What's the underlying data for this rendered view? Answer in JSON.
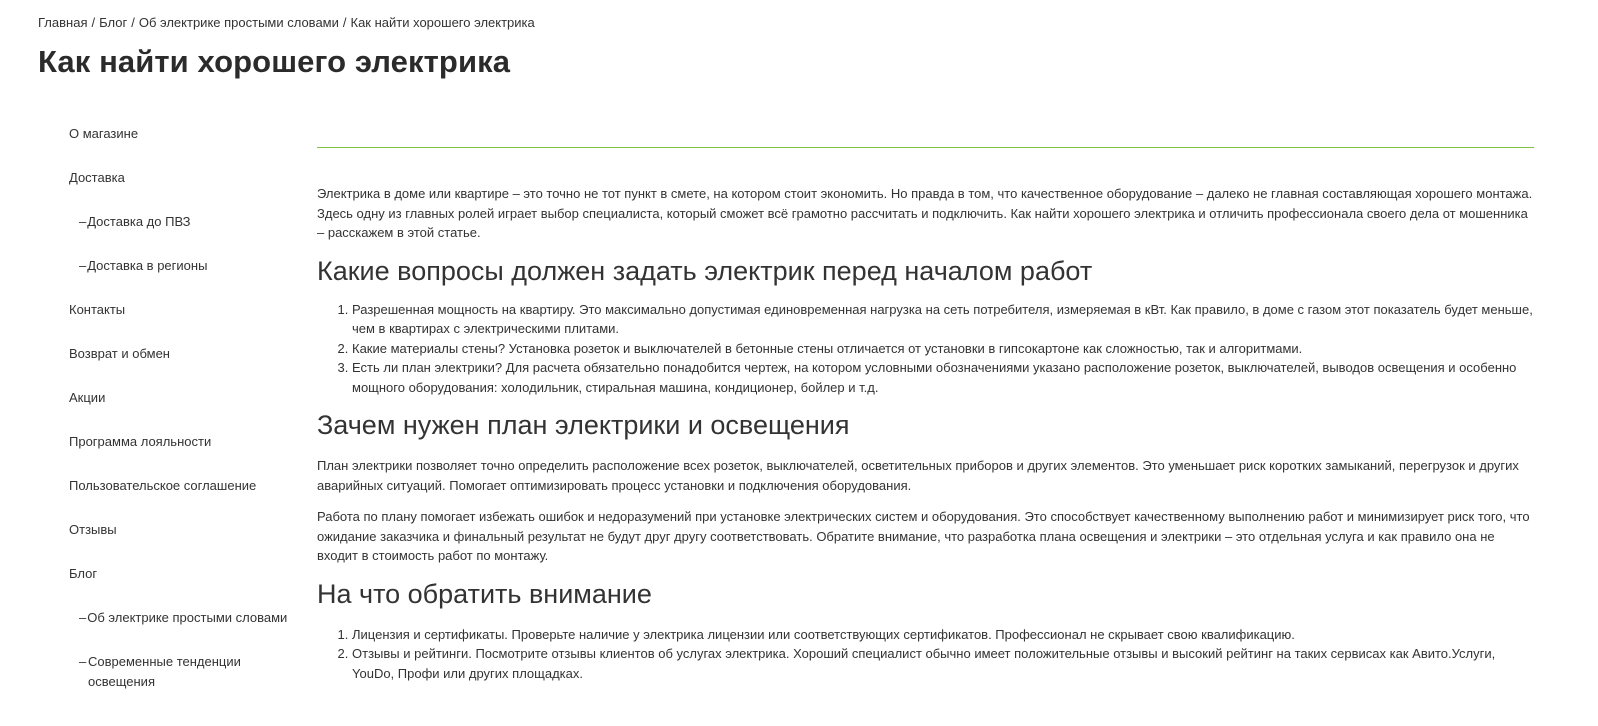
{
  "breadcrumb": [
    {
      "label": "Главная"
    },
    {
      "label": "Блог"
    },
    {
      "label": "Об электрике простыми словами"
    },
    {
      "label": "Как найти хорошего электрика"
    }
  ],
  "breadcrumb_separator": "/",
  "page_title": "Как найти хорошего электрика",
  "sidebar": {
    "items": [
      {
        "label": "О магазине"
      },
      {
        "label": "Доставка"
      },
      {
        "label": "Доставка до ПВЗ"
      },
      {
        "label": "Доставка в регионы"
      },
      {
        "label": "Контакты"
      },
      {
        "label": "Возврат и обмен"
      },
      {
        "label": "Акции"
      },
      {
        "label": "Программа лояльности"
      },
      {
        "label": "Пользовательское соглашение"
      },
      {
        "label": "Отзывы"
      },
      {
        "label": "Блог"
      },
      {
        "label": "Об электрике простыми словами"
      },
      {
        "label": "Современные тенденции освещения"
      }
    ],
    "dash": "–"
  },
  "article": {
    "intro": "Электрика в доме или квартире – это точно не тот пункт в смете, на котором стоит экономить. Но правда в том, что качественное оборудование – далеко не главная составляющая хорошего монтажа. Здесь одну из главных ролей играет выбор специалиста, который сможет всё грамотно рассчитать и подключить. Как найти хорошего электрика и отличить профессионала своего дела от мошенника – расскажем в этой статье.",
    "h2_questions": "Какие вопросы должен задать электрик перед началом работ",
    "questions": [
      "Разрешенная мощность на квартиру. Это максимально допустимая единовременная нагрузка на сеть потребителя, измеряемая в кВт. Как правило, в доме с газом этот показатель будет меньше, чем в квартирах с электрическими плитами.",
      "Какие материалы стены? Установка розеток и выключателей в бетонные стены отличается от установки в гипсокартоне как сложностью, так и алгоритмами.",
      "Есть ли план электрики? Для расчета обязательно понадобится чертеж, на котором условными обозначениями указано расположение розеток, выключателей, выводов освещения и особенно мощного оборудования: холодильник, стиральная машина, кондиционер, бойлер и т.д."
    ],
    "h2_plan": "Зачем нужен план электрики и освещения",
    "plan_p1": "План электрики позволяет точно определить расположение всех розеток, выключателей, осветительных приборов и других элементов. Это уменьшает риск коротких замыканий, перегрузок и других аварийных ситуаций. Помогает оптимизировать процесс установки и подключения оборудования.",
    "plan_p2": "Работа по плану помогает избежать ошибок и недоразумений при установке электрических систем и оборудования. Это способствует качественному выполнению работ и минимизирует риск того, что ожидание заказчика и финальный результат не будут друг другу соответствовать. Обратите внимание, что разработка плана освещения и электрики – это отдельная услуга и как правило она не входит в стоимость работ по монтажу.",
    "h2_attention": "На что обратить внимание",
    "attention": [
      "Лицензия и сертификаты. Проверьте наличие у электрика лицензии или соответствующих сертификатов. Профессионал не скрывает свою квалификацию.",
      "Отзывы и рейтинги. Посмотрите отзывы клиентов об услугах электрика. Хороший специалист обычно имеет положительные отзывы и высокий рейтинг на таких сервисах как Авито.Услуги, YouDo, Профи или других площадках."
    ]
  },
  "colors": {
    "accent_line": "#7cc240",
    "text": "#333333"
  }
}
